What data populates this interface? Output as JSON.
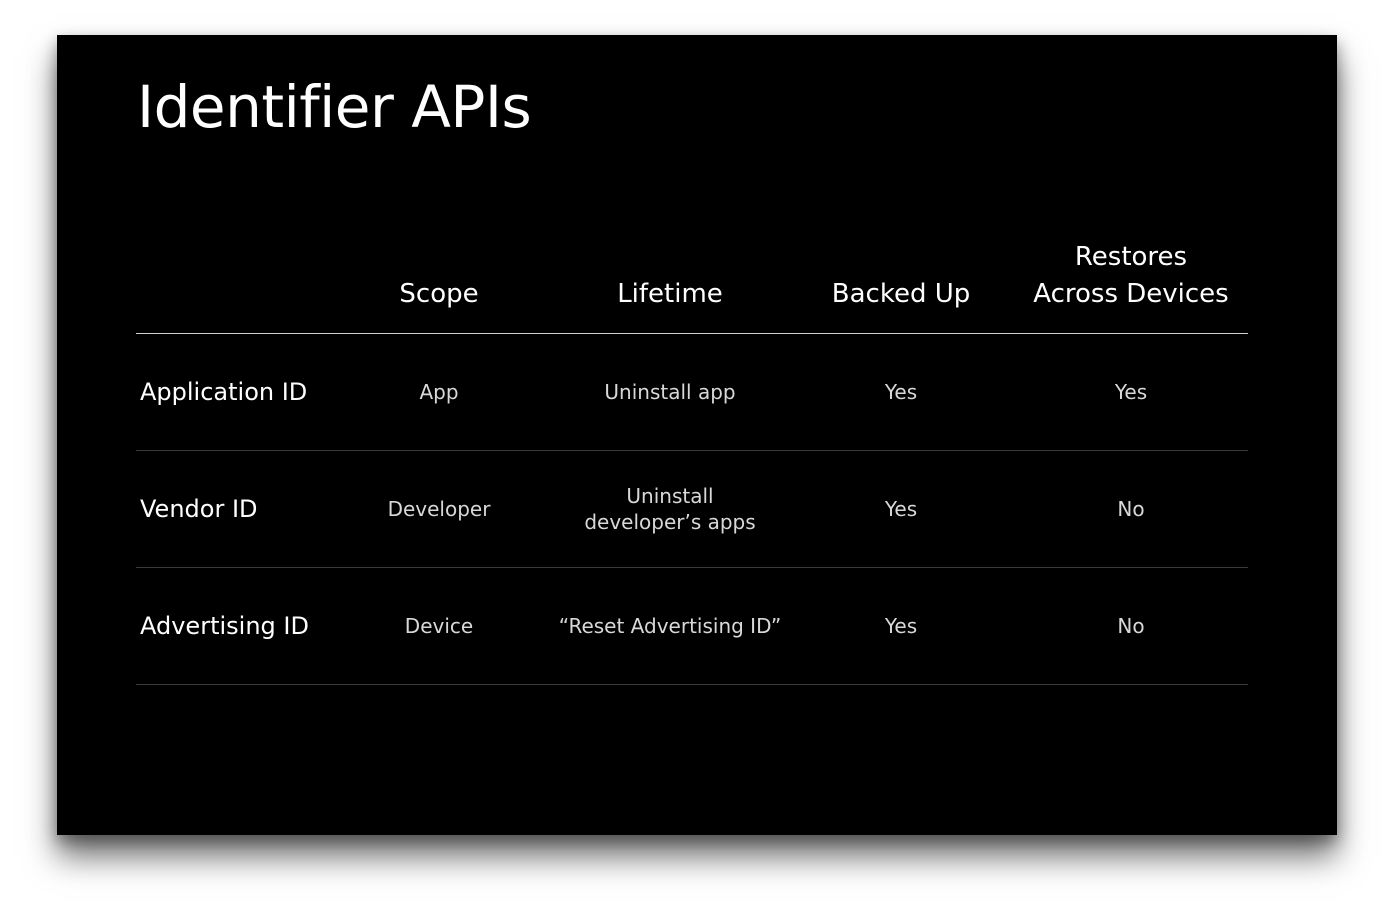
{
  "title": "Identifier APIs",
  "table": {
    "headers": [
      "Scope",
      "Lifetime",
      "Backed Up",
      "Restores\nAcross Devices"
    ],
    "rows": [
      {
        "name": "Application ID",
        "scope": "App",
        "lifetime": "Uninstall app",
        "backed_up": "Yes",
        "restores": "Yes"
      },
      {
        "name": "Vendor ID",
        "scope": "Developer",
        "lifetime": "Uninstall\ndeveloper’s apps",
        "backed_up": "Yes",
        "restores": "No"
      },
      {
        "name": "Advertising ID",
        "scope": "Device",
        "lifetime": "“Reset Advertising ID”",
        "backed_up": "Yes",
        "restores": "No"
      }
    ]
  }
}
